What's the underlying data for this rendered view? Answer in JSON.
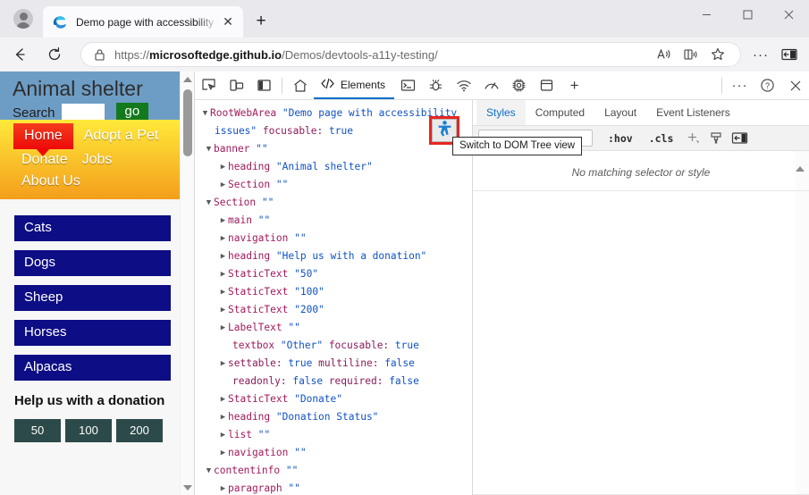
{
  "browser": {
    "tab": {
      "title": "Demo page with accessibility issues",
      "favicon_name": "edge-logo-icon",
      "close_label": "✕"
    },
    "new_tab_label": "+",
    "window_controls": {
      "minimize": "—",
      "maximize": "□",
      "close": "✕"
    },
    "nav": {
      "back": "←",
      "reload": "↻"
    },
    "url": {
      "scheme": "https://",
      "host": "microsoftedge.github.io",
      "path": "/Demos/devtools-a11y-testing/",
      "full": "https://microsoftedge.github.io/Demos/devtools-a11y-testing/"
    },
    "toolbar_icons": [
      "read-aloud-icon",
      "immersive-reader-icon",
      "favorite-star-icon",
      "settings-more-icon",
      "collections-icon"
    ]
  },
  "page": {
    "title": "Animal shelter",
    "search_label": "Search",
    "search_value": "",
    "go_label": "go",
    "nav_links": [
      "Home",
      "Adopt a Pet",
      "Donate",
      "Jobs",
      "About Us"
    ],
    "animals": [
      "Cats",
      "Dogs",
      "Sheep",
      "Horses",
      "Alpacas"
    ],
    "donation_heading": "Help us with a donation",
    "donation_amounts": [
      "50",
      "100",
      "200"
    ],
    "colors": {
      "header_bg": "#6d9dc5",
      "nav_gradient_top": "#ffe93a",
      "nav_gradient_bottom": "#f49e1b",
      "home_red": "#ee0a0a",
      "go_green": "#127a1c",
      "animal_blue": "#0d0d85",
      "amount_teal": "#2d4a4a"
    }
  },
  "devtools": {
    "toolbar": {
      "inspect_icon": "inspect-element-icon",
      "device_icon": "device-emulation-icon",
      "dock_icon": "dock-panel-icon",
      "home_icon": "welcome-home-icon",
      "elements_label": "Elements",
      "elements_icon": "code-brackets-icon",
      "panels": [
        "console-icon",
        "sources-bug-icon",
        "network-wifi-icon",
        "performance-gauge-icon",
        "memory-chip-icon",
        "application-database-icon"
      ],
      "add_panel_label": "+",
      "more_label": "···",
      "help_label": "?",
      "close_label": "✕"
    },
    "a11y_toggle": {
      "icon_name": "accessibility-person-icon",
      "tooltip": "Switch to DOM Tree view",
      "highlight_color": "#e8251f"
    },
    "tree": [
      {
        "indent": 0,
        "twist": "▼",
        "role": "RootWebArea",
        "value": "\"Demo page with accessibility",
        "wrap": "issues\"",
        "prop": "focusable:",
        "pv": "true"
      },
      {
        "indent": 1,
        "twist": "▼",
        "role": "banner",
        "value": "\"\""
      },
      {
        "indent": 2,
        "twist": "▶",
        "role": "heading",
        "value": "\"Animal shelter\""
      },
      {
        "indent": 2,
        "twist": "▶",
        "role": "Section",
        "value": "\"\""
      },
      {
        "indent": 1,
        "twist": "▼",
        "role": "Section",
        "value": "\"\""
      },
      {
        "indent": 2,
        "twist": "▶",
        "role": "main",
        "value": "\"\""
      },
      {
        "indent": 2,
        "twist": "▶",
        "role": "navigation",
        "value": "\"\""
      },
      {
        "indent": 2,
        "twist": "▶",
        "role": "heading",
        "value": "\"Help us with a donation\""
      },
      {
        "indent": 2,
        "twist": "▶",
        "role": "StaticText",
        "value": "\"50\""
      },
      {
        "indent": 2,
        "twist": "▶",
        "role": "StaticText",
        "value": "\"100\""
      },
      {
        "indent": 2,
        "twist": "▶",
        "role": "StaticText",
        "value": "\"200\""
      },
      {
        "indent": 2,
        "twist": "▶",
        "role": "LabelText",
        "value": "\"\""
      },
      {
        "indent": 2,
        "twist": "▶",
        "role": "textbox",
        "value": "\"Other\"",
        "multiline": true,
        "line1_prop": "focusable:",
        "line1_pv": "true",
        "line2_prop": "settable:",
        "line2_pv": "true",
        "line2_prop2": "multiline:",
        "line2_pv2": "false",
        "line3_prop": "readonly:",
        "line3_pv": "false",
        "line3_prop2": "required:",
        "line3_pv2": "false"
      },
      {
        "indent": 2,
        "twist": "▶",
        "role": "StaticText",
        "value": "\"Donate\""
      },
      {
        "indent": 2,
        "twist": "▶",
        "role": "heading",
        "value": "\"Donation Status\""
      },
      {
        "indent": 2,
        "twist": "▶",
        "role": "list",
        "value": "\"\""
      },
      {
        "indent": 2,
        "twist": "▶",
        "role": "navigation",
        "value": "\"\""
      },
      {
        "indent": 1,
        "twist": "▼",
        "role": "contentinfo",
        "value": "\"\""
      },
      {
        "indent": 2,
        "twist": "▶",
        "role": "paragraph",
        "value": "\"\""
      }
    ],
    "styles": {
      "tabs": [
        "Styles",
        "Computed",
        "Layout",
        "Event Listeners"
      ],
      "active_tab": "Styles",
      "filter_placeholder": "",
      "hov_label": ":hov",
      "cls_label": ".cls",
      "new_rule_label": "+",
      "toolbar_icons": [
        "new-style-rule-icon",
        "element-state-brush-icon",
        "computed-sidebar-icon"
      ],
      "empty_message": "No matching selector or style"
    }
  }
}
